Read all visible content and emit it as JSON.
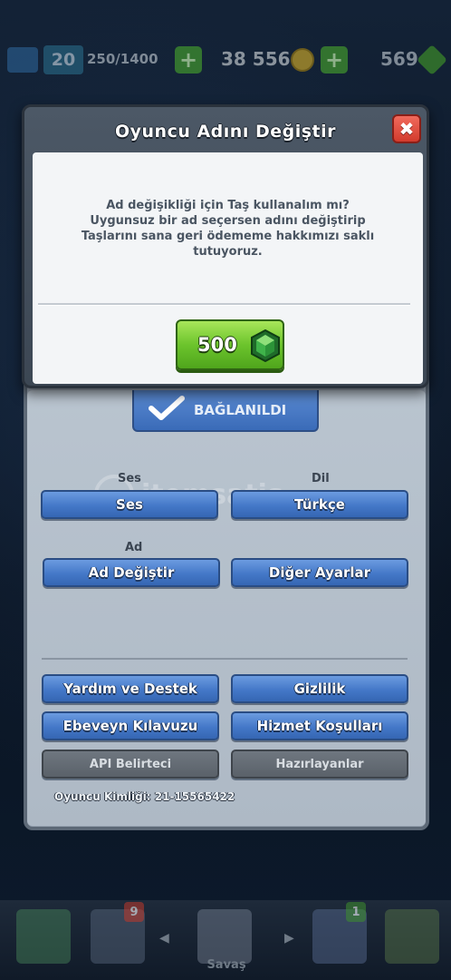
{
  "topbar": {
    "level": "20",
    "xp": "250/1400",
    "gold": "38 556",
    "gems": "569",
    "plus_label": "+"
  },
  "dialog": {
    "title": "Oyuncu Adını Değiştir",
    "close_label": "✖",
    "message": "Ad değişikliği için Taş kullanalım mı?\nUygunsuz bir ad seçersen adını değiştirip\nTaşlarını sana geri ödememe hakkımızı saklı\ntutuyoruz.",
    "price": "500"
  },
  "settings": {
    "connected_label": "BAĞLANILDI",
    "sound_caption": "Ses",
    "sound_button": "Ses",
    "language_caption": "Dil",
    "language_button": "Türkçe",
    "name_caption": "Ad",
    "change_name_button": "Ad Değiştir",
    "other_settings_button": "Diğer Ayarlar",
    "help_button": "Yardım ve Destek",
    "privacy_button": "Gizlilik",
    "parents_guide_button": "Ebeveyn Kılavuzu",
    "terms_button": "Hizmet Koşulları",
    "api_token_button": "API Belirteci",
    "credits_button": "Hazırlayanlar",
    "player_id": "Oyuncu Kimliği: 21-15565422"
  },
  "watermark": "itemsatis",
  "bottomnav": {
    "cards_badge": "9",
    "clan_badge": "1",
    "battle_label": "Savaş",
    "left_arrow": "◀",
    "right_arrow": "▶"
  }
}
